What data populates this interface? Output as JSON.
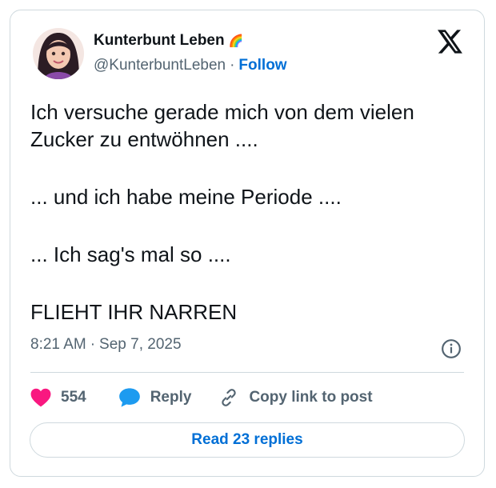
{
  "author": {
    "display_name": "Kunterbunt Leben",
    "name_emoji": "🌈",
    "handle": "@KunterbuntLeben",
    "separator": "·",
    "follow_label": "Follow",
    "avatar_icon": "avatar-woman-portrait"
  },
  "tweet": {
    "paragraphs": [
      "Ich versuche gerade mich von dem vielen Zucker zu entwöhnen ....",
      "... und ich habe meine Periode ....",
      "... Ich sag's mal so ....",
      "FLIEHT IHR NARREN"
    ],
    "time": "8:21 AM",
    "date_separator": "·",
    "date": "Sep 7, 2025"
  },
  "actions": {
    "like_count": "554",
    "reply_label": "Reply",
    "copy_label": "Copy link to post"
  },
  "footer": {
    "read_replies_label": "Read 23 replies"
  },
  "icons": {
    "platform": "x-logo-icon",
    "like": "heart-icon",
    "reply": "speech-bubble-icon",
    "copy": "link-icon",
    "info": "info-icon"
  },
  "colors": {
    "heart": "#f91880",
    "reply_bubble": "#1d9bf0",
    "link_blue": "#006fd6",
    "secondary_text": "#536471",
    "border": "#cfd9de"
  }
}
